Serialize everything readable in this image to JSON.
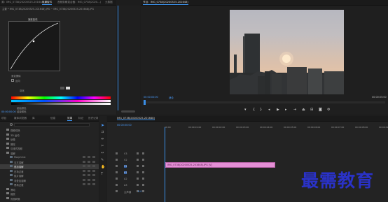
{
  "effect_controls": {
    "tabs": [
      "源：IMG_0738(20200525-201648).JPG",
      "效果控件",
      "音频剪辑混合器：IMG_0738(2020...)",
      "元数据"
    ],
    "clip_header": "主要 * IMG_0738(20200525-201648).JPG ~ IMG_0738(20200525-201648).JPG",
    "graph_label": "速度曲线",
    "effect_label": "渐变擦除",
    "options": [
      "反向",
      "羽化"
    ],
    "bottom_labels": [
      "起始颜色",
      "结束颜色"
    ],
    "timecode": "00:00:00:00"
  },
  "program_monitor": {
    "title": "节目：IMG_0738(20200525-201648)",
    "timecode": "00:00:00:00",
    "fit": "适合",
    "duration": "00:00:05:00"
  },
  "project_panel": {
    "tabs": [
      "项目",
      "媒体浏览器",
      "库",
      "信息",
      "效果",
      "标记",
      "历史记录"
    ],
    "search_placeholder": "",
    "tree": [
      {
        "label": "视频切换",
        "indent": 1,
        "highlight": false
      },
      {
        "label": "3D 运动",
        "indent": 1,
        "highlight": false
      },
      {
        "label": "划像",
        "indent": 1,
        "highlight": false
      },
      {
        "label": "擦除",
        "indent": 1,
        "highlight": false
      },
      {
        "label": "沉浸式视频",
        "indent": 1,
        "highlight": false
      },
      {
        "label": "溶解",
        "indent": 1,
        "highlight": false
      },
      {
        "label": "MorphCut",
        "indent": 2,
        "highlight": false
      },
      {
        "label": "交叉溶解",
        "indent": 2,
        "highlight": false
      },
      {
        "label": "叠加溶解",
        "indent": 2,
        "highlight": true
      },
      {
        "label": "白场过渡",
        "indent": 2,
        "highlight": false
      },
      {
        "label": "胶片溶解",
        "indent": 2,
        "highlight": false
      },
      {
        "label": "非叠加溶解",
        "indent": 2,
        "highlight": false
      },
      {
        "label": "黑场过渡",
        "indent": 2,
        "highlight": false
      },
      {
        "label": "滑动",
        "indent": 1,
        "highlight": false
      },
      {
        "label": "缩放",
        "indent": 1,
        "highlight": false
      },
      {
        "label": "页面剥落",
        "indent": 1,
        "highlight": false
      }
    ]
  },
  "timeline": {
    "title": "IMG_0738(20200525-201648)",
    "timecode": "00:00:00:00",
    "ruler": [
      "00:00",
      "00:00:01:00",
      "00:00:02:00",
      "00:00:03:00",
      "00:00:04:00",
      "00:00:05:00",
      "00:00:06:00",
      "00:00:07:00",
      "00:00:08:00",
      "00:00:09:00"
    ],
    "tracks": [
      "V3",
      "V2",
      "V1",
      "A1",
      "A2",
      "A3",
      "主声道"
    ],
    "master_value": "0.0",
    "clip_label": "IMG_0738(20200525-201648).JPG [V]"
  },
  "watermark": "最需教育",
  "colors": {
    "accent": "#3a8ee6",
    "clip": "#e58fd6",
    "timecode": "#4a9cff",
    "watermark": "#2a32c8"
  }
}
